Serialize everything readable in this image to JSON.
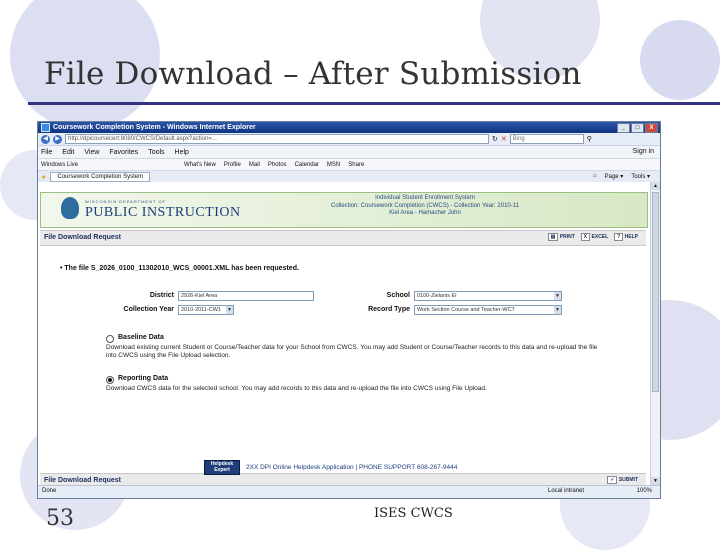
{
  "slide": {
    "title": "File Download – After Submission",
    "number": "53",
    "footer": "ISES CWCS",
    "accent_color": "#33337f",
    "decoration_color": "#d9dcf2"
  },
  "browser": {
    "window_title": "Coursework Completion System - Windows Internet Explorer",
    "window_buttons": [
      "_",
      "□",
      "X"
    ],
    "address_url": "http://dpicoursecert:8080/CWCS/Default.aspx?action=...",
    "search_placeholder": "Bing",
    "menu": [
      "File",
      "Edit",
      "View",
      "Favorites",
      "Tools",
      "Help"
    ],
    "signin_label": "Sign in",
    "links": [
      "Windows Live",
      "What's New",
      "Profile",
      "Mail",
      "Photos",
      "Calendar",
      "MSN",
      "Share"
    ],
    "tab_label": "Coursework Completion System",
    "tools": [
      "Page ▾",
      "Tools ▾"
    ],
    "status_left": "Done",
    "status_zone": "Local intranet",
    "status_zoom": "100%"
  },
  "page": {
    "logo_small": "WISCONSIN DEPARTMENT OF",
    "logo_text": "PUBLIC INSTRUCTION",
    "banner_lines": [
      "Individual Student Enrollment System",
      "Collection: Coursework Completion (CWCS) - Collection Year: 2010-11",
      "Kiel Area - Hamacher John"
    ],
    "section1_title": "File Download Request",
    "section1_icons": [
      "PRINT",
      "EXCEL",
      "HELP"
    ],
    "requested_message": "The file S_2026_0100_11302010_WCS_00001.XML has been requested.",
    "fields": {
      "district_label": "District",
      "district_value": "2926-Kiel Area",
      "school_label": "School",
      "school_value": "0100-Zielanis El",
      "collection_year_label": "Collection Year",
      "collection_year_value": "2010-2011-CW1",
      "record_type_label": "Record Type",
      "record_type_value": "Work Section Course and Teacher-WCT"
    },
    "options": [
      {
        "label": "Baseline Data",
        "selected": false,
        "description": "Download existing current Student or Course/Teacher data for your School from CWCS. You may add Student or Course/Teacher records to this data and re-upload the file into CWCS using the File Upload selection."
      },
      {
        "label": "Reporting Data",
        "selected": true,
        "description": "Download CWCS data for the selected school. You may add records to this data and re-upload the file into CWCS using File Upload."
      }
    ],
    "section2_title": "File Download Request",
    "submit_label": "SUBMIT",
    "helpdesk_logo": "Helpdesk Expert",
    "helpdesk_text": "2XX DPI Online Helpdesk Application | PHONE SUPPORT 608-267-9444"
  }
}
